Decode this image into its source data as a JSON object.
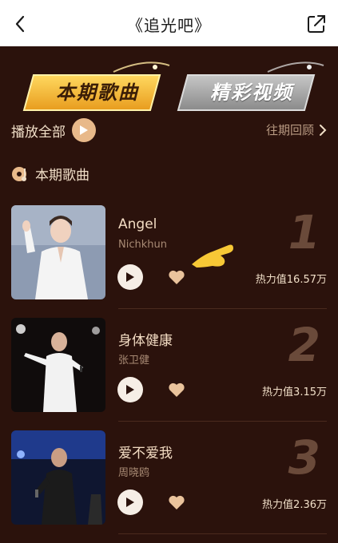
{
  "topbar": {
    "title": "《追光吧》",
    "back_icon": "chevron-left-icon",
    "share_icon": "share-icon"
  },
  "tabs": [
    {
      "label": "本期歌曲",
      "active": true
    },
    {
      "label": "精彩视频",
      "active": false
    }
  ],
  "controls": {
    "play_all": "播放全部",
    "history": "往期回顾"
  },
  "section": {
    "title": "本期歌曲"
  },
  "songs": [
    {
      "rank": "1",
      "title": "Angel",
      "artist": "Nichkhun",
      "heat": "热力值16.57万"
    },
    {
      "rank": "2",
      "title": "身体健康",
      "artist": "张卫健",
      "heat": "热力值3.15万"
    },
    {
      "rank": "3",
      "title": "爱不爱我",
      "artist": "周晓鸥",
      "heat": "热力值2.36万"
    }
  ],
  "colors": {
    "accent": "#e8b98a",
    "background": "#2b120c",
    "text": "#f1dfc8",
    "tab_active": "#f4b62e"
  }
}
